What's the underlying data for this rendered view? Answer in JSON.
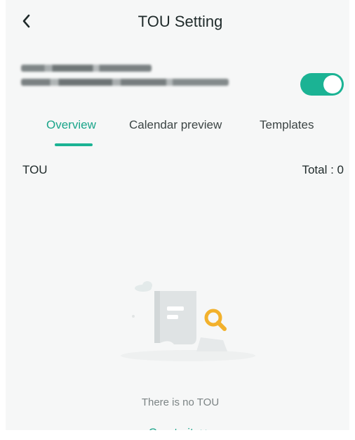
{
  "header": {
    "title": "TOU Setting",
    "back_icon": "chevron-left-icon"
  },
  "account": {
    "enabled": true,
    "accent_color": "#1bb394"
  },
  "tabs": [
    {
      "label": "Overview",
      "active": true
    },
    {
      "label": "Calendar preview",
      "active": false
    },
    {
      "label": "Templates",
      "active": false
    }
  ],
  "tou_list": {
    "label": "TOU",
    "total_text": "Total : 0"
  },
  "empty_state": {
    "icon": "empty-document-search-icon",
    "message": "There is no TOU",
    "create_label": "Create it",
    "create_icon": "double-chevron-right-icon"
  }
}
